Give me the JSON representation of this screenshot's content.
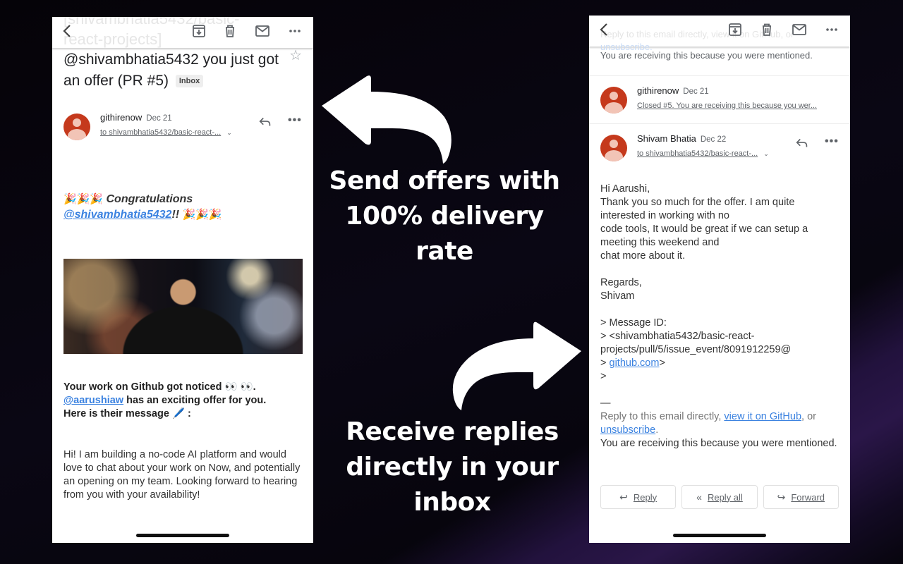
{
  "left_email": {
    "toolbar": {
      "ghost_text_line1": "[shivambhatia5432/basic-",
      "ghost_text_line2": "react-projects]",
      "icons": [
        "back-icon",
        "archive-icon",
        "trash-icon",
        "mail-icon",
        "more-icon"
      ]
    },
    "subject": "@shivambhatia5432 you just got an offer (PR #5)",
    "label_badge": "Inbox",
    "message": {
      "sender": "githirenow",
      "date": "Dec 21",
      "to": "to shivambhatia5432/basic-react-...",
      "congrats_emoji": "🎉🎉🎉",
      "congrats_text": "Congratulations",
      "mention": "@shivambhatia5432",
      "congrats_suffix": "!!",
      "gif_alt": "Celebration toast GIF",
      "notice_line1": "Your work on Github got noticed 👀 👀.",
      "notice_mention": "@aarushiaw",
      "notice_line2_rest": " has an exciting offer for you.",
      "notice_line3": "Here is their message 🖊️ :",
      "body": "Hi! I am building a no-code AI platform and would love to chat about your work on Now, and potentially an opening on my team. Looking forward to hearing from you with your availability!"
    }
  },
  "captions": {
    "send": "Send offers with 100% delivery rate",
    "receive": "Receive replies directly in your inbox"
  },
  "right_email": {
    "toolbar": {
      "ghost_text_line1": "Reply to this email directly, view it on GitHub, or",
      "ghost_text_line2": "unsubscribe."
    },
    "mentioned_top": "You are receiving this because you were mentioned.",
    "collapsed_message": {
      "sender": "githirenow",
      "date": "Dec 21",
      "snippet": "Closed #5. You are receiving this because you wer..."
    },
    "reply_message": {
      "sender": "Shivam Bhatia",
      "date": "Dec 22",
      "to": "to shivambhatia5432/basic-react-...",
      "greeting": "Hi Aarushi,",
      "body": "Thank you so much for the offer. I am quite\ninterested in working with no\ncode tools, It would be great if we can setup a\nmeeting this weekend and\nchat more about it.",
      "signoff": "Regards,\nShivam",
      "quote_line1": "> Message ID:",
      "quote_line2": "> <shivambhatia5432/basic-react-",
      "quote_line3": "projects/pull/5/issue_event/8091912259@",
      "quote_prefix": "> ",
      "quote_link": "github.com",
      "quote_suffix": ">",
      "quote_end": ">",
      "separator": "—",
      "footer_prefix": "Reply to this email directly, ",
      "footer_link1": "view it on GitHub",
      "footer_mid": ", or",
      "footer_link2": "unsubscribe",
      "footer_dot": ".",
      "footer_mentioned": "You are receiving this because you were mentioned."
    },
    "actions": [
      {
        "label": "Reply",
        "icon": "↩"
      },
      {
        "label": "Reply all",
        "icon": "«"
      },
      {
        "label": "Forward",
        "icon": "↪"
      }
    ]
  },
  "colors": {
    "link": "#3b82e0",
    "avatar": "#c5391c",
    "background": "#07050d"
  }
}
